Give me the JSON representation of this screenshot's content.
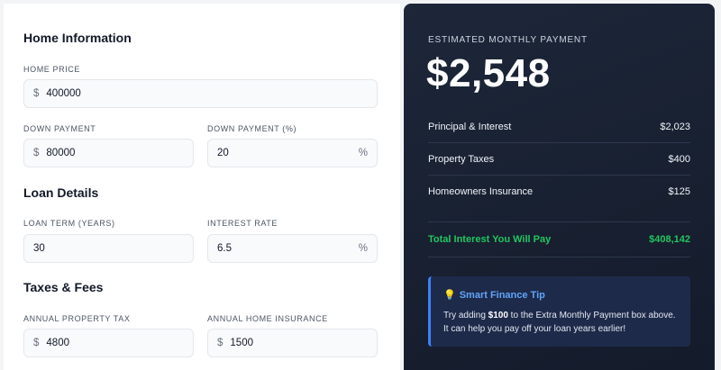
{
  "sections": {
    "home_information": "Home Information",
    "loan_details": "Loan Details",
    "taxes_fees": "Taxes & Fees"
  },
  "fields": {
    "home_price": {
      "label": "HOME PRICE",
      "prefix": "$",
      "value": "400000"
    },
    "down_payment": {
      "label": "DOWN PAYMENT",
      "prefix": "$",
      "value": "80000"
    },
    "down_payment_pct": {
      "label": "DOWN PAYMENT (%)",
      "suffix": "%",
      "value": "20"
    },
    "loan_term": {
      "label": "LOAN TERM (YEARS)",
      "value": "30"
    },
    "interest_rate": {
      "label": "INTEREST RATE",
      "suffix": "%",
      "value": "6.5"
    },
    "annual_property_tax": {
      "label": "ANNUAL PROPERTY TAX",
      "prefix": "$",
      "value": "4800"
    },
    "annual_home_insurance": {
      "label": "ANNUAL HOME INSURANCE",
      "prefix": "$",
      "value": "1500"
    }
  },
  "summary": {
    "label": "ESTIMATED MONTHLY PAYMENT",
    "amount": "$2,548",
    "rows": [
      {
        "label": "Principal & Interest",
        "value": "$2,023"
      },
      {
        "label": "Property Taxes",
        "value": "$400"
      },
      {
        "label": "Homeowners Insurance",
        "value": "$125"
      }
    ],
    "total": {
      "label": "Total Interest You Will Pay",
      "value": "$408,142"
    }
  },
  "tip": {
    "icon": "lightbulb-icon",
    "title": "Smart Finance Tip",
    "text_before": "Try adding ",
    "text_bold": "$100",
    "text_after": " to the Extra Monthly Payment box above. It can help you pay off your loan years earlier!"
  },
  "colors": {
    "panel_bg": "#1d2739",
    "accent_green": "#22c55e",
    "accent_blue": "#3b82f6",
    "tip_title": "#60a5fa"
  }
}
